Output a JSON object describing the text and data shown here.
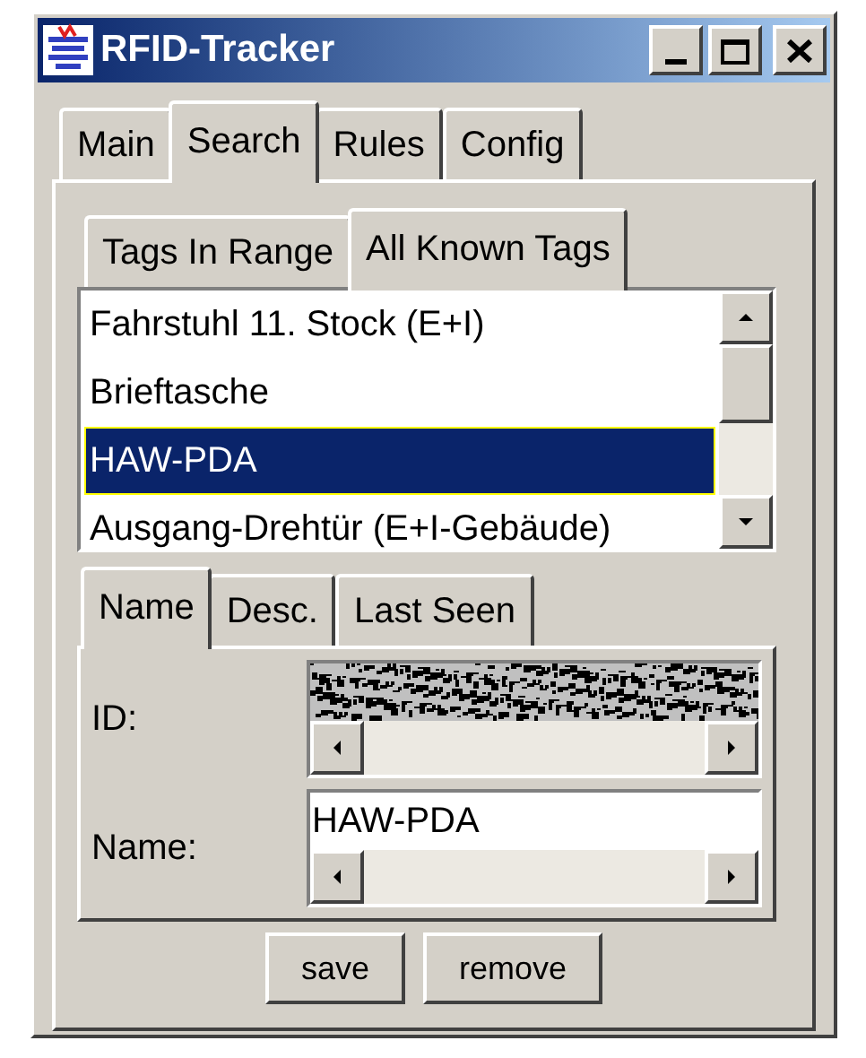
{
  "window": {
    "title": "RFID-Tracker"
  },
  "tabs": [
    {
      "label": "Main",
      "selected": false
    },
    {
      "label": "Search",
      "selected": true
    },
    {
      "label": "Rules",
      "selected": false
    },
    {
      "label": "Config",
      "selected": false
    }
  ],
  "subtabs": [
    {
      "label": "Tags In Range",
      "selected": false
    },
    {
      "label": "All Known Tags",
      "selected": true
    }
  ],
  "tag_list": [
    {
      "label": "Fahrstuhl 11. Stock (E+I)",
      "selected": false
    },
    {
      "label": "Brieftasche",
      "selected": false
    },
    {
      "label": "HAW-PDA",
      "selected": true
    },
    {
      "label": "Ausgang-Drehtür (E+I-Gebäude)",
      "selected": false
    }
  ],
  "detail_tabs": [
    {
      "label": "Name",
      "selected": true
    },
    {
      "label": "Desc.",
      "selected": false
    },
    {
      "label": "Last Seen",
      "selected": false
    }
  ],
  "fields": [
    {
      "label": "ID:",
      "kind": "obscured"
    },
    {
      "label": "Name:",
      "kind": "text",
      "value": "HAW-PDA"
    }
  ],
  "buttons": [
    "save",
    "remove"
  ]
}
